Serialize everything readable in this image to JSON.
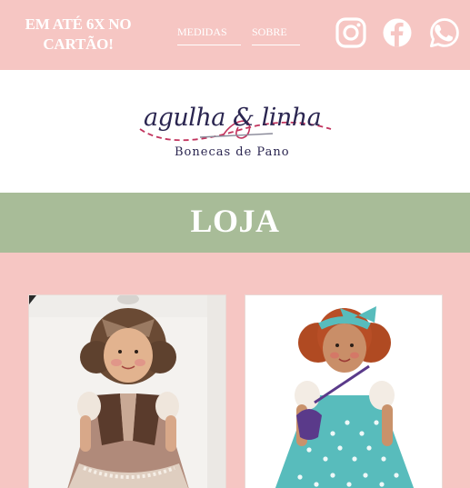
{
  "topbar": {
    "promo_text": "EM ATÉ 6X NO CARTÃO!",
    "nav": [
      {
        "label": "MEDIDAS"
      },
      {
        "label": "SOBRE"
      }
    ],
    "social_icons": [
      "instagram-icon",
      "facebook-icon",
      "whatsapp-icon"
    ]
  },
  "header": {
    "logo_script": "agulha & linha",
    "logo_tagline": "Bonecas de Pano"
  },
  "banner": {
    "title": "LOJA"
  },
  "products": [
    {
      "image": "doll-brown-dress"
    },
    {
      "image": "doll-turquoise-polka-dress"
    }
  ],
  "colors": {
    "background": "#f6c6c3",
    "banner": "#a8bc98",
    "header": "#ffffff",
    "logo_navy": "#2a2550",
    "logo_accent": "#c2345e"
  }
}
